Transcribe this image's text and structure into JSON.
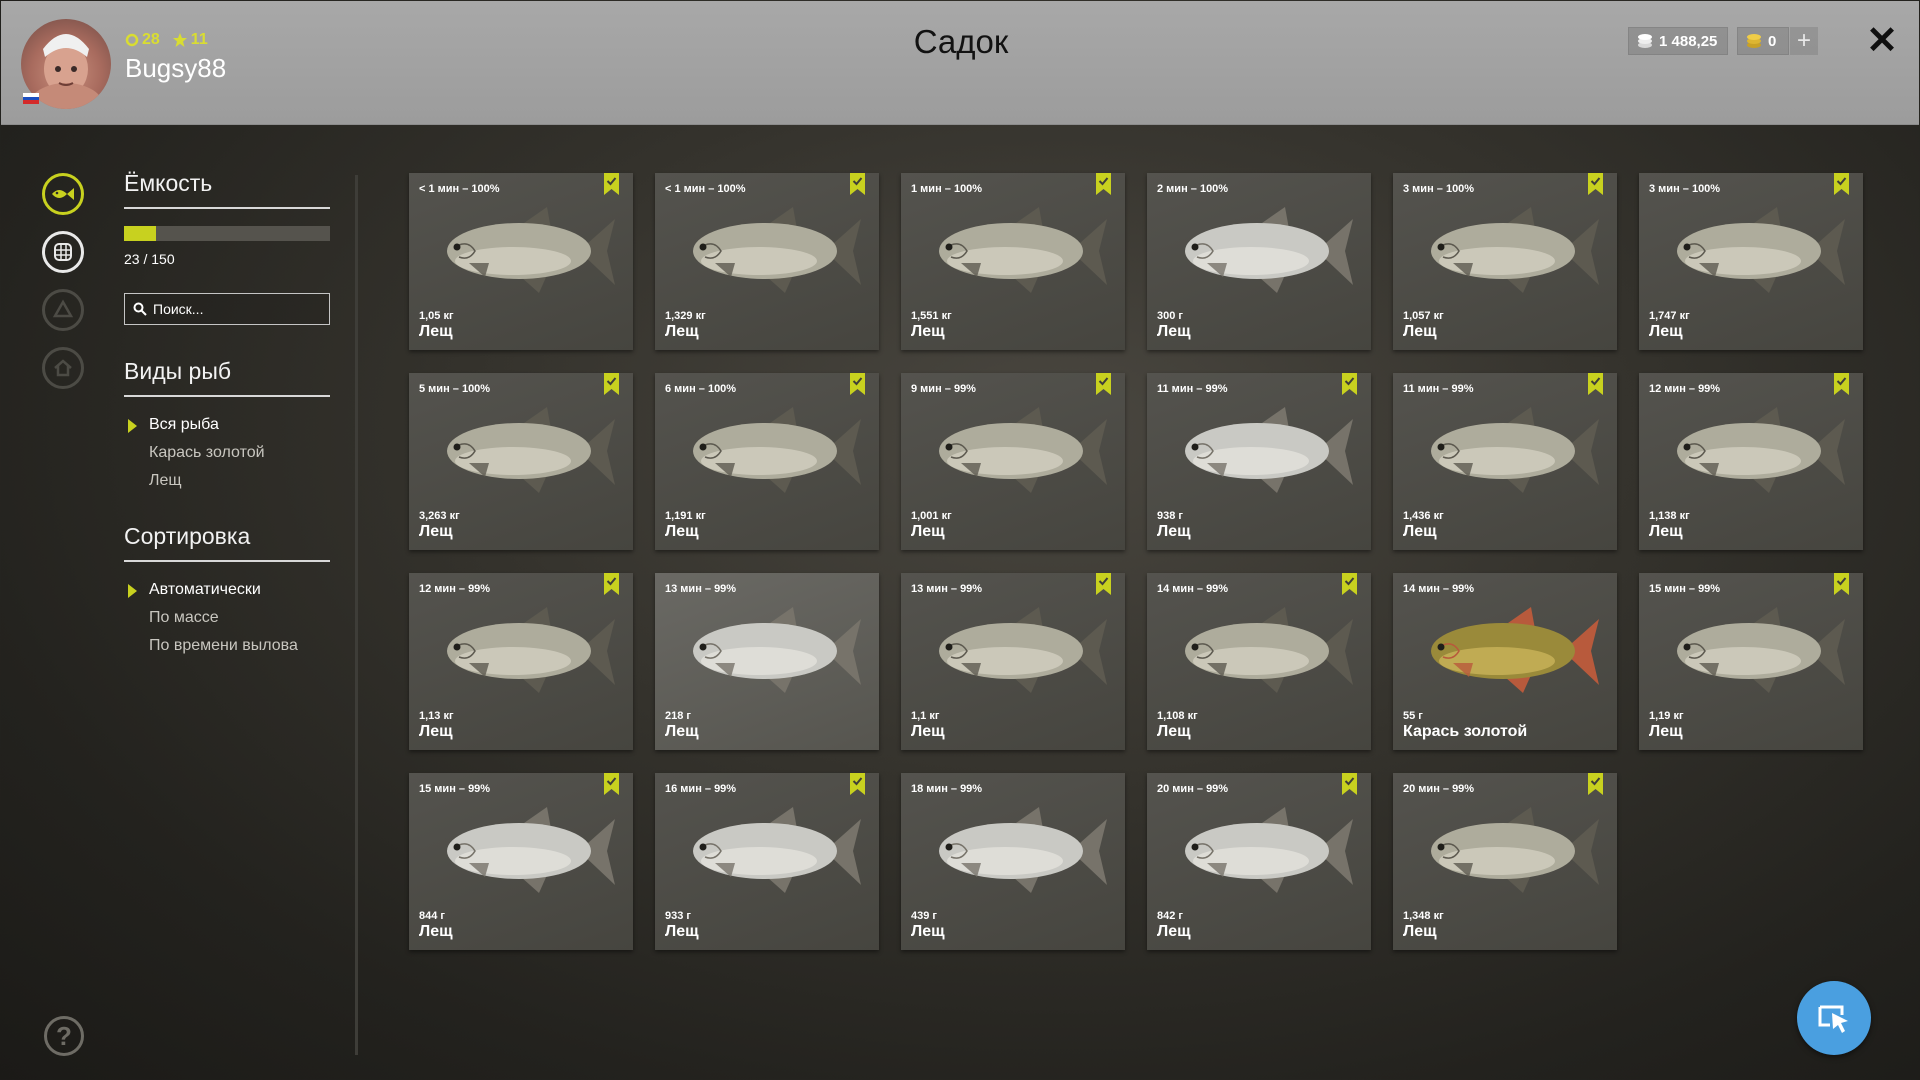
{
  "header": {
    "title": "Садок",
    "player": {
      "level": "28",
      "rank": "11",
      "username": "Bugsy88",
      "avatar_icon": "player-avatar",
      "flag_icon": "russia-flag"
    },
    "silver": "1 488,25",
    "gold": "0",
    "add_icon": "plus-icon",
    "close_icon": "close-icon"
  },
  "rail": {
    "items": [
      {
        "icon": "fish-icon",
        "state": "active"
      },
      {
        "icon": "keepnet-icon",
        "state": "normal"
      },
      {
        "icon": "boat-icon",
        "state": "disabled"
      },
      {
        "icon": "home-icon",
        "state": "disabled"
      }
    ],
    "help_icon": "help-icon"
  },
  "sidebar": {
    "capacity": {
      "title": "Ёмкость",
      "text": "23 / 150",
      "fill_fraction": 0.153
    },
    "search": {
      "placeholder": "Поиск..."
    },
    "species": {
      "title": "Виды рыб",
      "items": [
        "Вся рыба",
        "Карась золотой",
        "Лещ"
      ],
      "selected": 0
    },
    "sort": {
      "title": "Сортировка",
      "items": [
        "Автоматически",
        "По массе",
        "По времени вылова"
      ],
      "selected": 0
    }
  },
  "accent_color": "#c8d11f",
  "fish": [
    {
      "time": "< 1 мин – 100%",
      "weight": "1,05 кг",
      "name": "Лещ",
      "marked": true,
      "kind": "bream"
    },
    {
      "time": "< 1 мин – 100%",
      "weight": "1,329 кг",
      "name": "Лещ",
      "marked": true,
      "kind": "bream"
    },
    {
      "time": "1 мин – 100%",
      "weight": "1,551 кг",
      "name": "Лещ",
      "marked": true,
      "kind": "bream"
    },
    {
      "time": "2 мин – 100%",
      "weight": "300 г",
      "name": "Лещ",
      "marked": false,
      "kind": "bream-silver"
    },
    {
      "time": "3 мин – 100%",
      "weight": "1,057 кг",
      "name": "Лещ",
      "marked": true,
      "kind": "bream"
    },
    {
      "time": "3 мин – 100%",
      "weight": "1,747 кг",
      "name": "Лещ",
      "marked": true,
      "kind": "bream"
    },
    {
      "time": "5 мин – 100%",
      "weight": "3,263 кг",
      "name": "Лещ",
      "marked": true,
      "kind": "bream"
    },
    {
      "time": "6 мин – 100%",
      "weight": "1,191 кг",
      "name": "Лещ",
      "marked": true,
      "kind": "bream"
    },
    {
      "time": "9 мин – 99%",
      "weight": "1,001 кг",
      "name": "Лещ",
      "marked": true,
      "kind": "bream"
    },
    {
      "time": "11 мин – 99%",
      "weight": "938 г",
      "name": "Лещ",
      "marked": true,
      "kind": "bream-silver"
    },
    {
      "time": "11 мин – 99%",
      "weight": "1,436 кг",
      "name": "Лещ",
      "marked": true,
      "kind": "bream"
    },
    {
      "time": "12 мин – 99%",
      "weight": "1,138 кг",
      "name": "Лещ",
      "marked": true,
      "kind": "bream"
    },
    {
      "time": "12 мин – 99%",
      "weight": "1,13 кг",
      "name": "Лещ",
      "marked": true,
      "kind": "bream"
    },
    {
      "time": "13 мин – 99%",
      "weight": "218 г",
      "name": "Лещ",
      "marked": false,
      "kind": "bream-silver"
    },
    {
      "time": "13 мин – 99%",
      "weight": "1,1 кг",
      "name": "Лещ",
      "marked": true,
      "kind": "bream"
    },
    {
      "time": "14 мин – 99%",
      "weight": "1,108 кг",
      "name": "Лещ",
      "marked": true,
      "kind": "bream"
    },
    {
      "time": "14 мин – 99%",
      "weight": "55 г",
      "name": "Карась золотой",
      "marked": false,
      "kind": "carp"
    },
    {
      "time": "15 мин – 99%",
      "weight": "1,19 кг",
      "name": "Лещ",
      "marked": true,
      "kind": "bream"
    },
    {
      "time": "15 мин – 99%",
      "weight": "844 г",
      "name": "Лещ",
      "marked": true,
      "kind": "bream-silver"
    },
    {
      "time": "16 мин – 99%",
      "weight": "933 г",
      "name": "Лещ",
      "marked": true,
      "kind": "bream-silver"
    },
    {
      "time": "18 мин – 99%",
      "weight": "439 г",
      "name": "Лещ",
      "marked": false,
      "kind": "bream-silver"
    },
    {
      "time": "20 мин – 99%",
      "weight": "842 г",
      "name": "Лещ",
      "marked": true,
      "kind": "bream-silver"
    },
    {
      "time": "20 мин – 99%",
      "weight": "1,348 кг",
      "name": "Лещ",
      "marked": true,
      "kind": "bream"
    }
  ],
  "cursor_button_icon": "cursor-mode-icon",
  "cursor_button_color": "#4a9fe0"
}
